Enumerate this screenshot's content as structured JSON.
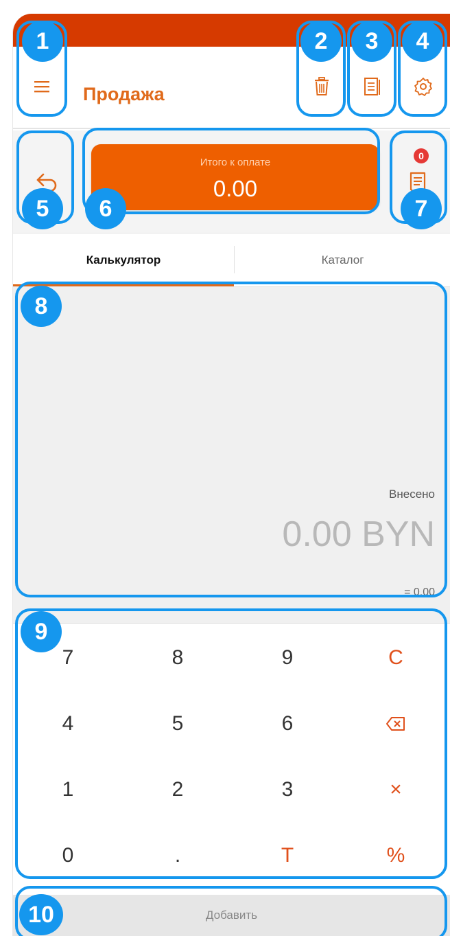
{
  "app": {
    "title": "Продажа"
  },
  "total": {
    "label": "Итого к оплате",
    "value": "0.00"
  },
  "receipt": {
    "badge_count": "0"
  },
  "tabs": [
    {
      "label": "Калькулятор"
    },
    {
      "label": "Каталог"
    }
  ],
  "display": {
    "label": "Внесено",
    "amount": "0.00 BYN",
    "equals": "= 0.00"
  },
  "keypad": {
    "row1": [
      "7",
      "8",
      "9",
      "C"
    ],
    "row2": [
      "4",
      "5",
      "6"
    ],
    "row3": [
      "1",
      "2",
      "3",
      "×"
    ],
    "row4": [
      "0",
      ".",
      "T",
      "%"
    ]
  },
  "add_button": {
    "label": "Добавить"
  },
  "annotations": [
    "1",
    "2",
    "3",
    "4",
    "5",
    "6",
    "7",
    "8",
    "9",
    "10"
  ],
  "colors": {
    "accent": "#ee5f00",
    "statusbar": "#d63a00",
    "annotation": "#1597ee",
    "badge": "#e53935"
  }
}
